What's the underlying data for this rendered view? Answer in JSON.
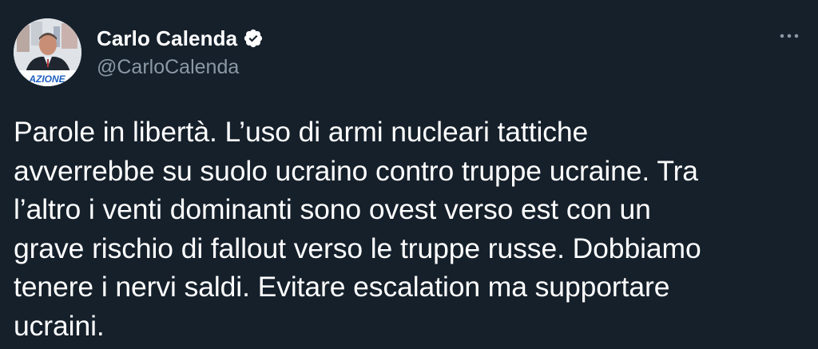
{
  "author": {
    "display_name": "Carlo Calenda",
    "handle": "@CarloCalenda",
    "verified": true,
    "avatar_badge_text": "AZIONE"
  },
  "tweet": {
    "text": "Parole in libertà. L’uso di armi nucleari tattiche\navverrebbe su suolo ucraino contro truppe ucraine. Tra\nl’altro i venti dominanti sono ovest verso est con un\ngrave rischio di fallout verso le truppe russe. Dobbiamo\ntenere i nervi saldi. Evitare escalation ma supportare\nucraini."
  },
  "icons": {
    "verified": "verified-badge-icon",
    "more": "more-options-icon"
  },
  "colors": {
    "background": "#15202b",
    "text_primary": "#ffffff",
    "text_secondary": "#8b98a5",
    "verified": "#ffffff"
  }
}
